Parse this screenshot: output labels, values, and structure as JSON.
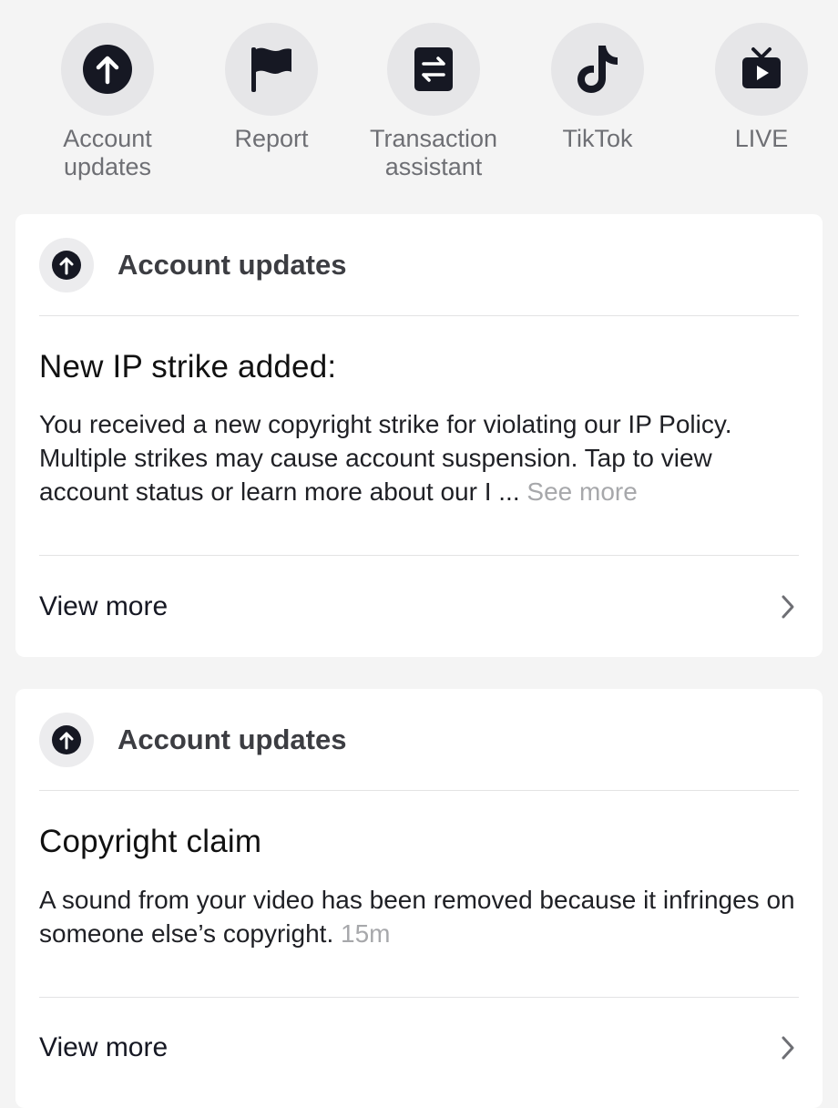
{
  "shortcuts": [
    {
      "label": "Account updates",
      "icon": "arrow-up-circle-icon"
    },
    {
      "label": "Report",
      "icon": "flag-icon"
    },
    {
      "label": "Transaction assistant",
      "icon": "transfer-icon"
    },
    {
      "label": "TikTok",
      "icon": "tiktok-logo-icon"
    },
    {
      "label": "LIVE",
      "icon": "live-tv-icon"
    }
  ],
  "cards": [
    {
      "header_title": "Account updates",
      "title": "New IP strike added:",
      "body": "You received a new copyright strike for violating our IP Policy. Multiple strikes may cause account suspension. Tap to view account status or learn more about our I ... ",
      "see_more": "See more",
      "view_more": "View more"
    },
    {
      "header_title": "Account updates",
      "title": "Copyright claim",
      "body": "A sound from your video has been removed because it infringes on someone else’s copyright. ",
      "timestamp": "15m",
      "view_more": "View more"
    }
  ],
  "colors": {
    "background": "#f4f4f4",
    "card": "#ffffff",
    "icon_dark": "#161823",
    "muted_text": "#a7a8ab"
  }
}
